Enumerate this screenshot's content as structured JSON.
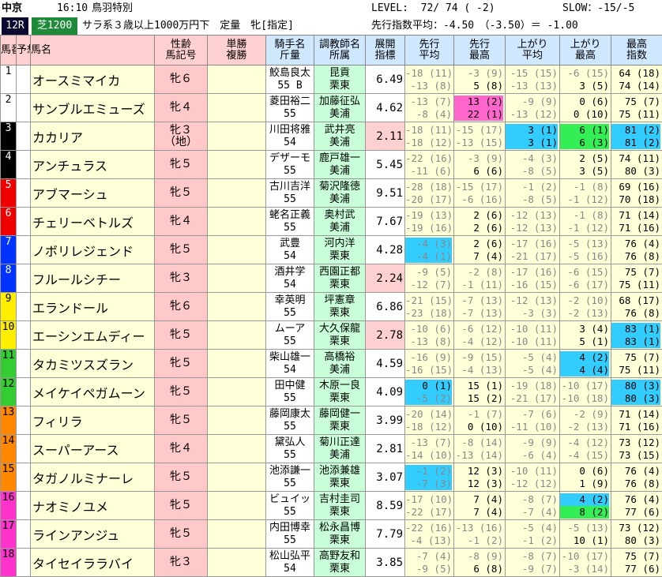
{
  "header": {
    "venue": "中京",
    "time": "16:10",
    "race_name": "鳥羽特別",
    "level": "LEVEL:  72/ 74 ( -2)",
    "slow": "SLOW：-15/-5",
    "race_no": "12R",
    "surface": "芝1200",
    "conditions": "サラ系３歳以上1000万円下　定量　牝[指定]",
    "pace_avg": "先行指数平均：-4.50　（-3.50）＝ -1.00"
  },
  "columns": {
    "num": "馬番",
    "yoso": "予想",
    "name": "馬名",
    "sex": "性齢",
    "mark": "馬記号",
    "tansho": "単勝",
    "fukusho": "複勝",
    "jockey": "騎手名",
    "weight": "斤量",
    "trainer": "調教師名",
    "stable": "所属",
    "tenkai": "展開",
    "shisu": "指標",
    "senko": "先行",
    "heikin": "平均",
    "saiko": "最高",
    "agari": "上がり",
    "saikoushisu": "指数"
  },
  "rows": [
    {
      "num": "1",
      "color": "#ffffff",
      "fg": "#000",
      "name": "オースミマイカ",
      "sex": "牝６",
      "sub": "",
      "jockey": "鮫島良太",
      "weight": "55 B",
      "trainer": "昆貢",
      "stable": "栗東",
      "idx": "6.49",
      "c": [
        [
          "-18 (11)",
          "-13 (8)"
        ],
        [
          "-3 (9)",
          "5 (8)"
        ],
        [
          "-15 (15)",
          "-13 (13)"
        ],
        [
          "-6 (15)",
          "3 (5)"
        ],
        [
          "64 (18)",
          "74 (14)"
        ]
      ]
    },
    {
      "num": "2",
      "color": "#ffffff",
      "fg": "#000",
      "name": "サンブルエミューズ",
      "sex": "牝４",
      "sub": "",
      "jockey": "菱田裕二",
      "weight": "55",
      "trainer": "加藤征弘",
      "stable": "美浦",
      "idx": "4.62",
      "c": [
        [
          "-13 (7)",
          "-8 (4)"
        ],
        [
          "13 (2)",
          "22 (1)"
        ],
        [
          "-9 (9)",
          "-13 (12)"
        ],
        [
          "0 (6)",
          "0 (10)"
        ],
        [
          "75 (7)",
          "75 (11)"
        ]
      ]
    },
    {
      "num": "3",
      "color": "#000000",
      "fg": "#fff",
      "name": "カカリア",
      "sex": "牝３",
      "sub": "（地）",
      "jockey": "川田将雅",
      "weight": "54",
      "trainer": "武井亮",
      "stable": "美浦",
      "idx": "2.11",
      "c": [
        [
          "-18 (11)",
          "-18 (12)"
        ],
        [
          "-15 (17)",
          "-13 (15)"
        ],
        [
          "3 (1)",
          "3 (1)"
        ],
        [
          "6 (1)",
          "6 (3)"
        ],
        [
          "81 (2)",
          "81 (2)"
        ]
      ]
    },
    {
      "num": "4",
      "color": "#000000",
      "fg": "#fff",
      "name": "アンチュラス",
      "sex": "牝５",
      "sub": "",
      "jockey": "デザーモ",
      "weight": "55",
      "trainer": "鹿戸雄一",
      "stable": "美浦",
      "idx": "5.45",
      "c": [
        [
          "-22 (16)",
          "-11 (6)"
        ],
        [
          "-3 (9)",
          "6 (6)"
        ],
        [
          "-4 (3)",
          "-8 (5)"
        ],
        [
          "2 (5)",
          "3 (5)"
        ],
        [
          "74 (11)",
          "80 (3)"
        ]
      ]
    },
    {
      "num": "5",
      "color": "#ee0000",
      "fg": "#fff",
      "name": "アブマーシュ",
      "sex": "牝５",
      "sub": "",
      "jockey": "古川吉洋",
      "weight": "55",
      "trainer": "菊沢隆徳",
      "stable": "美浦",
      "idx": "9.51",
      "c": [
        [
          "-28 (18)",
          "-20 (17)"
        ],
        [
          "-15 (17)",
          "-6 (16)"
        ],
        [
          "-1 (2)",
          "-8 (5)"
        ],
        [
          "-1 (8)",
          "-1 (12)"
        ],
        [
          "69 (16)",
          "70 (18)"
        ]
      ]
    },
    {
      "num": "6",
      "color": "#ee0000",
      "fg": "#fff",
      "name": "チェリーベトルズ",
      "sex": "牝４",
      "sub": "",
      "jockey": "蛯名正義",
      "weight": "55",
      "trainer": "奥村武",
      "stable": "美浦",
      "idx": "7.67",
      "c": [
        [
          "-19 (13)",
          "-19 (16)"
        ],
        [
          "2 (6)",
          "2 (6)"
        ],
        [
          "-12 (13)",
          "-12 (13)"
        ],
        [
          "-1 (8)",
          "-1 (12)"
        ],
        [
          "71 (14)",
          "71 (16)"
        ]
      ]
    },
    {
      "num": "7",
      "color": "#0033ff",
      "fg": "#fff",
      "name": "ノボリレジェンド",
      "sex": "牝５",
      "sub": "",
      "jockey": "武豊",
      "weight": "54",
      "trainer": "河内洋",
      "stable": "栗東",
      "idx": "4.28",
      "c": [
        [
          "-4 (3)",
          "-4 (1)"
        ],
        [
          "2 (6)",
          "7 (4)"
        ],
        [
          "-17 (16)",
          "-21 (17)"
        ],
        [
          "-5 (13)",
          "-5 (16)"
        ],
        [
          "76 (4)",
          "76 (8)"
        ]
      ]
    },
    {
      "num": "8",
      "color": "#0033ff",
      "fg": "#fff",
      "name": "フルールシチー",
      "sex": "牝３",
      "sub": "",
      "jockey": "酒井学",
      "weight": "54",
      "trainer": "西園正都",
      "stable": "栗東",
      "idx": "2.24",
      "c": [
        [
          "-9 (5)",
          "-12 (7)"
        ],
        [
          "-2 (8)",
          "-1 (11)"
        ],
        [
          "-17 (16)",
          "-16 (15)"
        ],
        [
          "-6 (15)",
          "-6 (17)"
        ],
        [
          "75 (7)",
          "75 (11)"
        ]
      ]
    },
    {
      "num": "9",
      "color": "#ffee00",
      "fg": "#000",
      "name": "エランドール",
      "sex": "牝６",
      "sub": "",
      "jockey": "幸英明",
      "weight": "55",
      "trainer": "坪憲章",
      "stable": "栗東",
      "idx": "6.86",
      "c": [
        [
          "-21 (15)",
          "-23 (18)"
        ],
        [
          "-7 (13)",
          "-7 (13)"
        ],
        [
          "-12 (13)",
          "-3 (3)"
        ],
        [
          "-2 (10)",
          "-2 (13)"
        ],
        [
          "68 (17)",
          "76 (8)"
        ]
      ]
    },
    {
      "num": "10",
      "color": "#ffee00",
      "fg": "#000",
      "name": "エーシンエムディー",
      "sex": "牝５",
      "sub": "",
      "jockey": "ムーア",
      "weight": "55",
      "trainer": "大久保龍",
      "stable": "栗東",
      "idx": "2.78",
      "c": [
        [
          "-10 (6)",
          "-13 (8)"
        ],
        [
          "-6 (12)",
          "-4 (12)"
        ],
        [
          "-10 (11)",
          "-10 (11)"
        ],
        [
          "3 (4)",
          "5 (1)"
        ],
        [
          "83 (1)",
          "83 (1)"
        ]
      ]
    },
    {
      "num": "11",
      "color": "#33cc33",
      "fg": "#000",
      "name": "タカミツスズラン",
      "sex": "牝５",
      "sub": "",
      "jockey": "柴山雄一",
      "weight": "54",
      "trainer": "高橋裕",
      "stable": "美浦",
      "idx": "4.59",
      "c": [
        [
          "-16 (9)",
          "-16 (15)"
        ],
        [
          "-9 (15)",
          "-4 (13)"
        ],
        [
          "-5 (4)",
          "-5 (4)"
        ],
        [
          "4 (2)",
          "4 (4)"
        ],
        [
          "75 (7)",
          "75 (11)"
        ]
      ]
    },
    {
      "num": "12",
      "color": "#33cc33",
      "fg": "#000",
      "name": "メイケイペガムーン",
      "sex": "牝５",
      "sub": "",
      "jockey": "田中健",
      "weight": "55",
      "trainer": "木原一良",
      "stable": "栗東",
      "idx": "4.09",
      "c": [
        [
          "0 (1)",
          "-5 (2)"
        ],
        [
          "15 (1)",
          "15 (2)"
        ],
        [
          "-19 (18)",
          "-21 (17)"
        ],
        [
          "-10 (17)",
          "-10 (18)"
        ],
        [
          "80 (3)",
          "80 (3)"
        ]
      ]
    },
    {
      "num": "13",
      "color": "#ff8800",
      "fg": "#000",
      "name": "フィリラ",
      "sex": "牝５",
      "sub": "",
      "jockey": "藤岡康太",
      "weight": "55",
      "trainer": "藤岡健一",
      "stable": "栗東",
      "idx": "3.99",
      "c": [
        [
          "-20 (14)",
          "-18 (12)"
        ],
        [
          "-1 (7)",
          "0 (10)"
        ],
        [
          "-7 (6)",
          "-11 (10)"
        ],
        [
          "-2 (9)",
          "-2 (13)"
        ],
        [
          "71 (14)",
          "71 (16)"
        ]
      ]
    },
    {
      "num": "14",
      "color": "#ff8800",
      "fg": "#000",
      "name": "スーパーアース",
      "sex": "牝４",
      "sub": "",
      "jockey": "黛弘人",
      "weight": "55",
      "trainer": "菊川正達",
      "stable": "美浦",
      "idx": "2.81",
      "c": [
        [
          "-13 (7)",
          "-14 (10)"
        ],
        [
          "-8 (14)",
          "-13 (14)"
        ],
        [
          "-9 (9)",
          "-6 (4)"
        ],
        [
          "-4 (12)",
          "-4 (15)"
        ],
        [
          "73 (12)",
          "73 (15)"
        ]
      ]
    },
    {
      "num": "15",
      "color": "#ff8800",
      "fg": "#000",
      "name": "タガノルミナーレ",
      "sex": "牝５",
      "sub": "",
      "jockey": "池添謙一",
      "weight": "55",
      "trainer": "池添兼雄",
      "stable": "栗東",
      "idx": "3.07",
      "c": [
        [
          "-1 (2)",
          "-7 (3)"
        ],
        [
          "12 (3)",
          "12 (3)"
        ],
        [
          "-10 (11)",
          "-12 (12)"
        ],
        [
          "0 (6)",
          "1 (9)"
        ],
        [
          "76 (4)",
          "76 (8)"
        ]
      ]
    },
    {
      "num": "16",
      "color": "#ff33cc",
      "fg": "#000",
      "name": "ナオミノユメ",
      "sex": "牝５",
      "sub": "",
      "jockey": "ビュイッ",
      "weight": "55",
      "trainer": "吉村圭司",
      "stable": "栗東",
      "idx": "8.59",
      "c": [
        [
          "-17 (10)",
          "-22 (17)"
        ],
        [
          "7 (4)",
          "7 (4)"
        ],
        [
          "-8 (7)",
          "-7 (4)"
        ],
        [
          "4 (2)",
          "8 (2)"
        ],
        [
          "76 (4)",
          "77 (6)"
        ]
      ]
    },
    {
      "num": "17",
      "color": "#ff33cc",
      "fg": "#000",
      "name": "ラインアンジュ",
      "sex": "牝５",
      "sub": "",
      "jockey": "内田博幸",
      "weight": "55",
      "trainer": "松永昌博",
      "stable": "栗東",
      "idx": "7.79",
      "c": [
        [
          "-22 (16)",
          "-4 (13)"
        ],
        [
          "-13 (16)",
          "-1 (2)"
        ],
        [
          "-5 (4)",
          "-1 (2)"
        ],
        [
          "-5 (13)",
          "10 (1)"
        ],
        [
          "73 (12)",
          "80 (3)"
        ]
      ]
    },
    {
      "num": "18",
      "color": "#ff33cc",
      "fg": "#000",
      "name": "タイセイララバイ",
      "sex": "牝３",
      "sub": "",
      "jockey": "松山弘平",
      "weight": "54",
      "trainer": "高野友和",
      "stable": "栗東",
      "idx": "3.85",
      "c": [
        [
          "-7 (4)",
          "-9 (5)"
        ],
        [
          "-8 (9)",
          "6 (8)"
        ],
        [
          "-8 (7)",
          "-9 (7)"
        ],
        [
          "-10 (17)",
          "-3 (14)"
        ],
        [
          "75 (7)",
          "77 (6)"
        ]
      ]
    }
  ],
  "highlights": {
    "3": {
      "2": [
        "cy",
        "cy"
      ],
      "3": [
        "gr",
        "gr"
      ],
      "4": [
        "cy",
        "cy"
      ]
    },
    "7": {
      "0": [
        "cy",
        "cy"
      ]
    },
    "10": {
      "4": [
        "cy",
        "cy"
      ]
    },
    "11": {
      "3": [
        "cy",
        "cy"
      ]
    },
    "12": {
      "0": [
        "cy",
        "cy"
      ],
      "4": [
        "cy",
        "cy"
      ]
    },
    "15": {
      "0": [
        "cy",
        "cy"
      ]
    },
    "16": {
      "3": [
        "cy",
        "gr"
      ]
    },
    "2": {
      "1": [
        "mg",
        "mg"
      ]
    }
  }
}
